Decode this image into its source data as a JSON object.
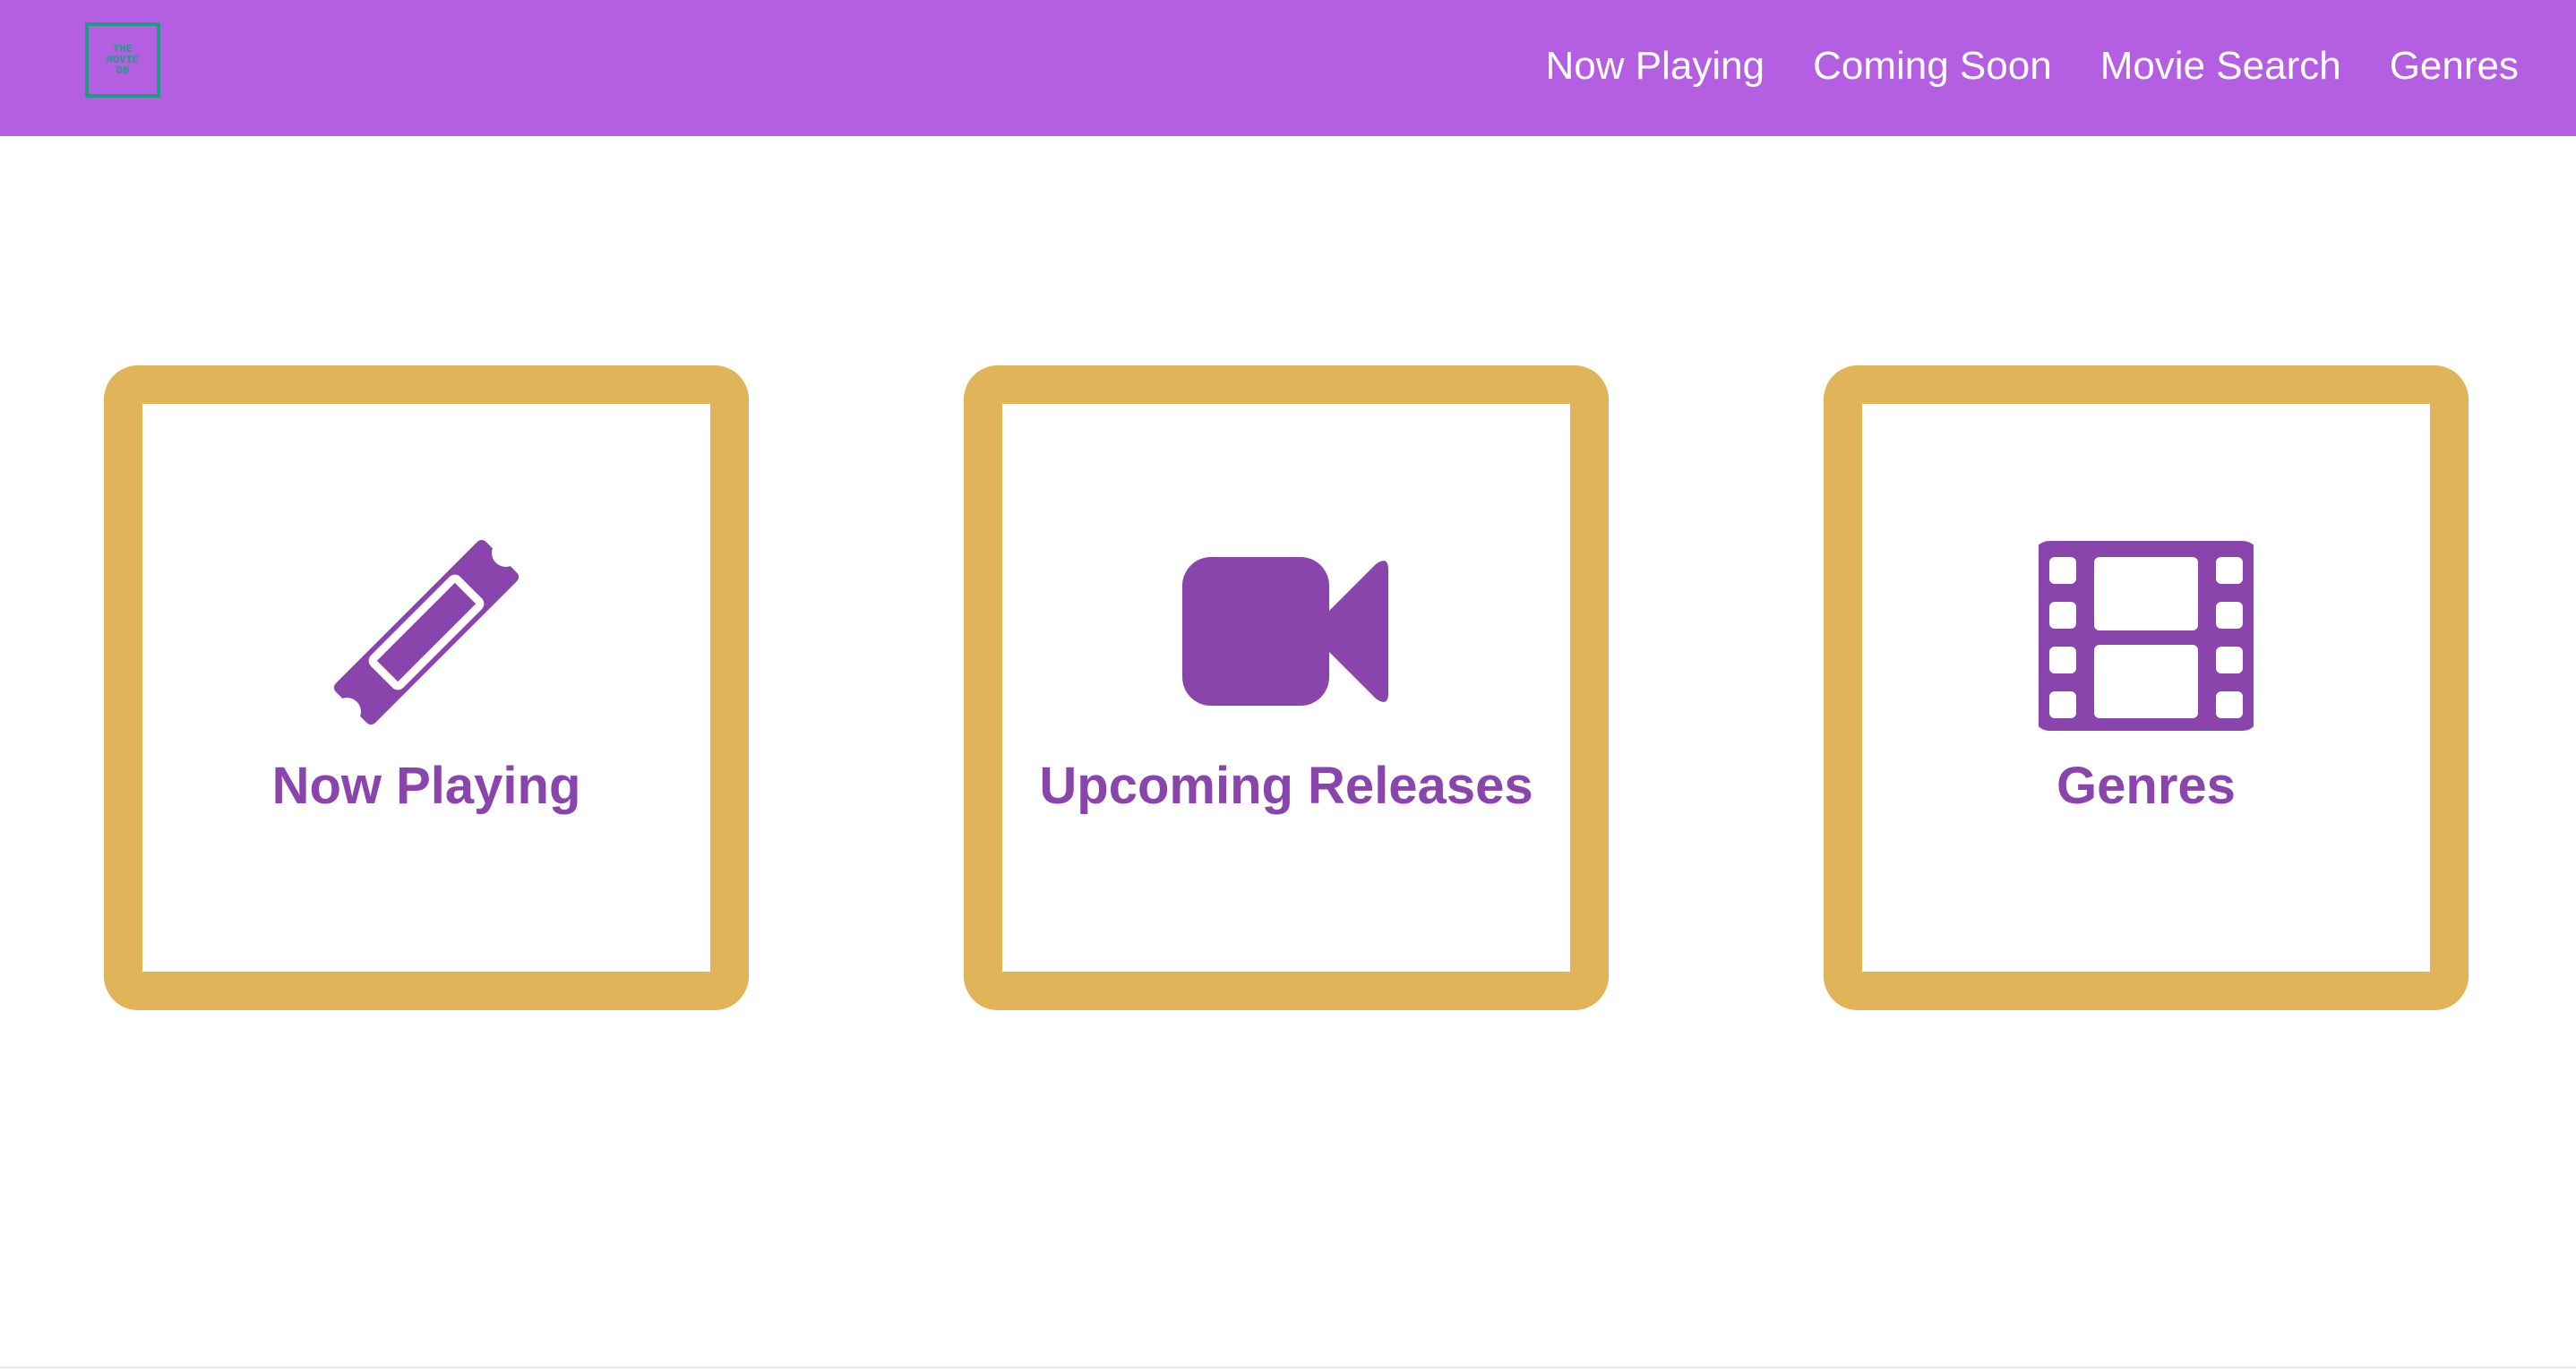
{
  "header": {
    "logo_lines": [
      "THE",
      "MOVIE",
      "DB"
    ],
    "logo_color": "#1f9d83",
    "background_color": "#b45ee2",
    "nav": [
      {
        "label": "Now Playing"
      },
      {
        "label": "Coming Soon"
      },
      {
        "label": "Movie Search"
      },
      {
        "label": "Genres"
      }
    ]
  },
  "cards": [
    {
      "icon": "ticket-icon",
      "label": "Now Playing"
    },
    {
      "icon": "video-camera-icon",
      "label": "Upcoming Releases"
    },
    {
      "icon": "film-icon",
      "label": "Genres"
    }
  ],
  "colors": {
    "card_border": "#e1b45a",
    "accent_purple": "#8a45ad",
    "nav_text": "#ffffff"
  }
}
